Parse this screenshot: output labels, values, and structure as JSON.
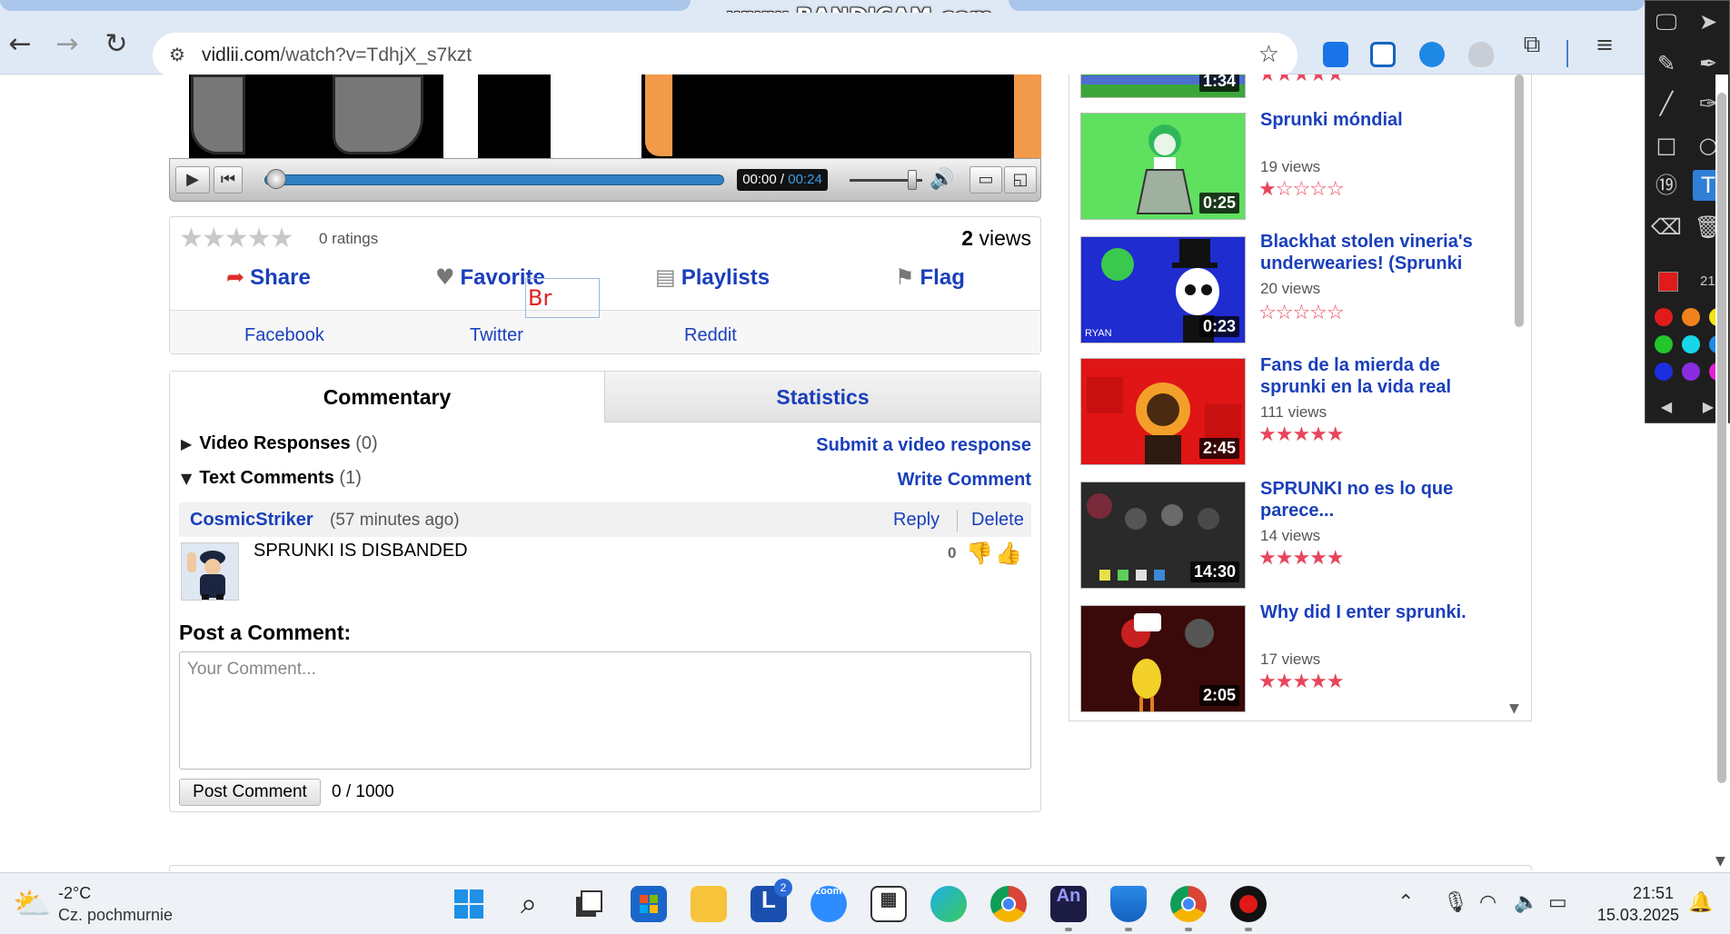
{
  "browser": {
    "url_host": "vidlii.com",
    "url_path": "/watch?v=TdhjX_s7kzt",
    "watermark": "www.BANDICAM.com"
  },
  "player": {
    "time_current": "00:00",
    "time_separator": " / ",
    "time_total": "00:24",
    "progress": 0.0
  },
  "info": {
    "ratings": "0 ratings",
    "views_count": "2",
    "views_label": " views",
    "actions": {
      "share": "Share",
      "favorite": "Favorite",
      "playlists": "Playlists",
      "flag": "Flag"
    },
    "share_links": {
      "facebook": "Facebook",
      "twitter": "Twitter",
      "reddit": "Reddit"
    },
    "annotation_text": "Br"
  },
  "comments": {
    "tabs": {
      "commentary": "Commentary",
      "statistics": "Statistics"
    },
    "video_responses": {
      "label": "Video Responses",
      "count": "(0)",
      "link": "Submit a video response"
    },
    "text_comments": {
      "label": "Text Comments",
      "count": "(1)",
      "link": "Write Comment"
    },
    "items": [
      {
        "author": "CosmicStriker",
        "time": "(57 minutes ago)",
        "reply": "Reply",
        "delete": "Delete",
        "text": "SPRUNKI IS DISBANDED",
        "votes": "0"
      }
    ],
    "post_title": "Post a Comment:",
    "placeholder": "Your Comment...",
    "post_button": "Post Comment",
    "char_count": "0 / 1000"
  },
  "related": [
    {
      "title": "",
      "views": "",
      "duration": "1:34",
      "rating": 0
    },
    {
      "title": "Sprunki móndial",
      "views": "19 views",
      "duration": "0:25",
      "rating": 1
    },
    {
      "title": "Blackhat stolen vineria's underwearies! (Sprunki",
      "views": "20 views",
      "duration": "0:23",
      "rating": 0
    },
    {
      "title": "Fans de la mierda de sprunki en la vida real",
      "views": "111 views",
      "duration": "2:45",
      "rating": 5
    },
    {
      "title": "SPRUNKI no es lo que parece...",
      "views": "14 views",
      "duration": "14:30",
      "rating": 5
    },
    {
      "title": "Why did I enter sprunki.",
      "views": "17 views",
      "duration": "2:05",
      "rating": 5
    }
  ],
  "palette": {
    "size": "21",
    "colors": [
      "#e01b1b",
      "#f0821e",
      "#f5e313",
      "#22c52a",
      "#16d6e8",
      "#1f88e5",
      "#1c2de0",
      "#8a2be2",
      "#e31fd6"
    ],
    "current_color": "#e01b1b"
  },
  "taskbar": {
    "weather_temp": "-2°C",
    "weather_desc": "Cz. pochmurnie",
    "l_badge": "2",
    "clock_time": "21:51",
    "clock_date": "15.03.2025"
  }
}
